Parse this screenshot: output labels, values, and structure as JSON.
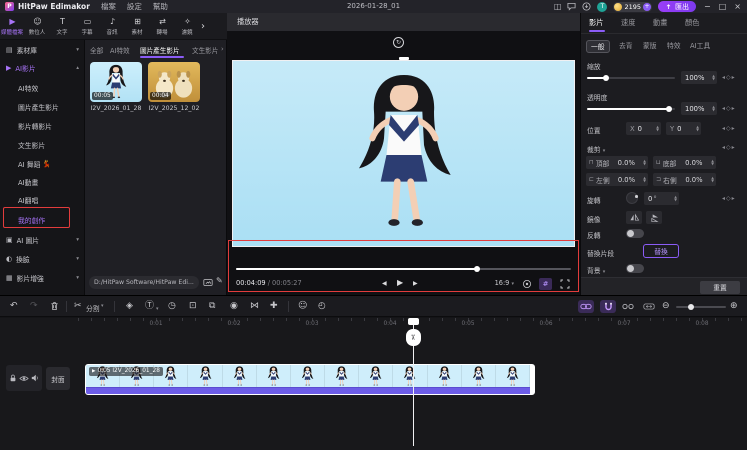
{
  "titlebar": {
    "app_name": "HitPaw Edimakor",
    "logo_letter": "P",
    "menus": [
      "檔案",
      "設定",
      "幫助"
    ],
    "project_title": "2026-01-28_01",
    "avatar_initial": "T",
    "credits": "2195",
    "plus": "+",
    "export_label": "匯出",
    "window_controls": [
      "−",
      "□",
      "×"
    ]
  },
  "ribbon": {
    "items": [
      {
        "label": "媒體檔案",
        "icon": "▶"
      },
      {
        "label": "數位人",
        "icon": "☺"
      },
      {
        "label": "文字",
        "icon": "T"
      },
      {
        "label": "字幕",
        "icon": "▭"
      },
      {
        "label": "音訊",
        "icon": "♪"
      },
      {
        "label": "素材",
        "icon": "⊞"
      },
      {
        "label": "轉場",
        "icon": "⇄"
      },
      {
        "label": "濾鏡",
        "icon": "✧"
      }
    ],
    "more": "›"
  },
  "sidebar": {
    "library_label": "素材庫",
    "ai_video_label": "AI影片",
    "ai_video_items": [
      "AI特效",
      "圖片產生影片",
      "影片轉影片",
      "文生影片",
      "AI 舞蹈",
      "AI動畫",
      "AI翻唱",
      "我的創作"
    ],
    "dance_emoji": "💃",
    "groups": [
      "AI 圖片",
      "換臉",
      "影片增強"
    ],
    "caret_down": "▾",
    "caret_up": "▴"
  },
  "media": {
    "tabs": [
      "全部",
      "AI特效",
      "圖片產生影片",
      "文生影片"
    ],
    "more": "›",
    "clips": [
      {
        "name": "I2V_2026_01_28",
        "duration": "00:05"
      },
      {
        "name": "I2V_2025_12_02",
        "duration": "00:04"
      }
    ],
    "path": "D:/HitPaw Software/HitPaw Edi...",
    "pen_icon": "✎"
  },
  "player": {
    "header": "播放器",
    "rotate_glyph": "↻",
    "current_time": "00:04:09",
    "total_time": " / 00:05:27",
    "prev_frame": "◀",
    "play": "▶",
    "next_frame": "▶",
    "aspect_ratio": "16:9",
    "ratio_caret": "▾",
    "grid_glyph": "#"
  },
  "inspector": {
    "tabs": [
      "影片",
      "速度",
      "動畫",
      "顏色"
    ],
    "subtabs": [
      "一般",
      "去背",
      "蒙版",
      "特效",
      "AI工具"
    ],
    "kf": "◂◇▸",
    "stepper_up": "▲",
    "stepper_down": "▼",
    "scale_label": "縮放",
    "scale_value": "100%",
    "opacity_label": "透明度",
    "opacity_value": "100%",
    "position_label": "位置",
    "pos_x_label": "X",
    "pos_x_value": "0",
    "pos_y_label": "Y",
    "pos_y_value": "0",
    "crop_label": "裁剪",
    "crop_caret": "▾",
    "crop_fields": [
      {
        "icon": "⊓",
        "label": "頂部",
        "value": "0.0%"
      },
      {
        "icon": "⊔",
        "label": "底部",
        "value": "0.0%"
      },
      {
        "icon": "⊏",
        "label": "左側",
        "value": "0.0%"
      },
      {
        "icon": "⊐",
        "label": "右側",
        "value": "0.0%"
      }
    ],
    "rotate_label": "旋轉",
    "rotate_value": "0",
    "rotate_unit": "°",
    "mirror_label": "鏡像",
    "reverse_label": "反轉",
    "replace_label": "替換片段",
    "replace_button": "替換",
    "background_label": "背景",
    "reset_label": "重置"
  },
  "timeline_toolbar": {
    "undo": "↶",
    "redo": "↷",
    "scissors": "✂",
    "split_label": "分割",
    "caret": "▾",
    "mask_tool": "◈",
    "text_tool": "Ⓣ",
    "speed_tool": "◷",
    "crop_tool": "⊡",
    "pip_tool": "⧉",
    "motion_tool": "◉",
    "mirror_tool": "⋈",
    "transform_tool": "✚",
    "face_tool": "☺",
    "history_tool": "◴",
    "zoom_out": "⊖",
    "zoom_in": "⊕"
  },
  "timeline": {
    "ruler": [
      "0:01",
      "0:02",
      "0:03",
      "0:04",
      "0:05",
      "0:06",
      "0:07",
      "0:08"
    ],
    "cover_label": "封面",
    "clip_badge": "▶",
    "clip_label": "0:05 I2V_2026_01_28",
    "scissor_glyph": "✂"
  },
  "colors": {
    "accent": "#8b5cf6",
    "export_purple": "#7c3aed",
    "annotation_red": "#e23c3c",
    "clip_purple": "#6c5ce7",
    "video_sky": "#aadff4",
    "coin_gold": "#e3a92f"
  }
}
